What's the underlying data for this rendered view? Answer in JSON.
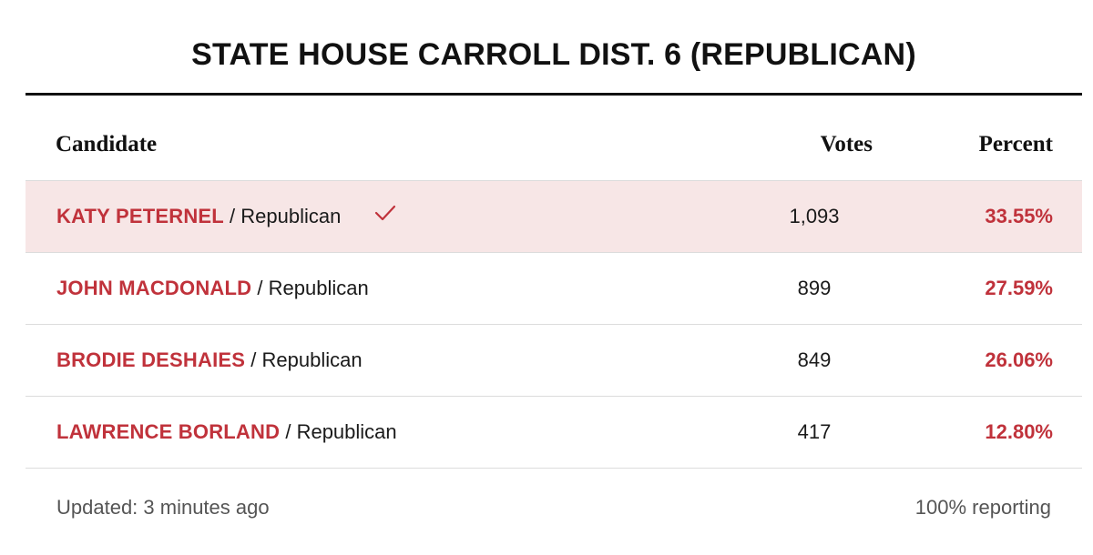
{
  "title": "STATE HOUSE CARROLL DIST. 6 (REPUBLICAN)",
  "columns": {
    "candidate": "Candidate",
    "votes": "Votes",
    "percent": "Percent"
  },
  "separator": "/",
  "rows": [
    {
      "name": "KATY PETERNEL",
      "party": "Republican",
      "votes": "1,093",
      "percent": "33.55%",
      "winner": true
    },
    {
      "name": "JOHN MACDONALD",
      "party": "Republican",
      "votes": "899",
      "percent": "27.59%",
      "winner": false
    },
    {
      "name": "BRODIE DESHAIES",
      "party": "Republican",
      "votes": "849",
      "percent": "26.06%",
      "winner": false
    },
    {
      "name": "LAWRENCE BORLAND",
      "party": "Republican",
      "votes": "417",
      "percent": "12.80%",
      "winner": false
    }
  ],
  "footer": {
    "updated": "Updated: 3 minutes ago",
    "reporting": "100% reporting"
  },
  "colors": {
    "accent": "#c0323b",
    "winner_bg": "#f7e6e6"
  },
  "icons": {
    "winner": "checkmark-icon"
  }
}
